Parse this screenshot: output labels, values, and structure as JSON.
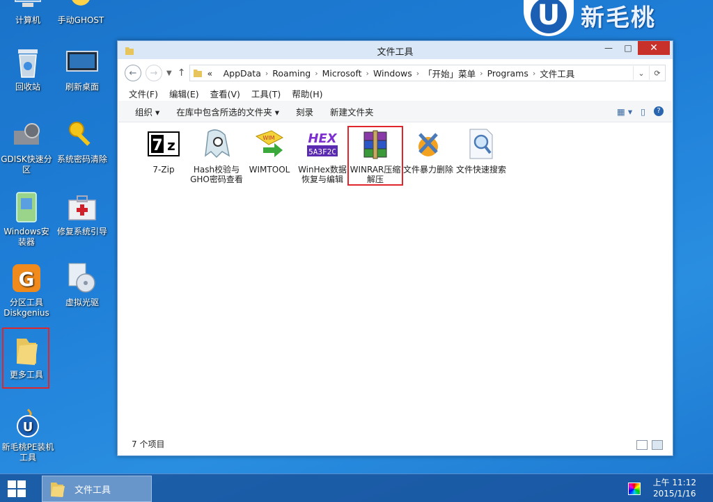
{
  "brand": {
    "logo_letter": "U",
    "text": "新毛桃"
  },
  "desktop": {
    "icons": [
      {
        "label": "计算机"
      },
      {
        "label": "手动GHOST"
      },
      {
        "label": "回收站"
      },
      {
        "label": "刷新桌面"
      },
      {
        "label": "GDISK快速分区"
      },
      {
        "label": "系统密码清除"
      },
      {
        "label": "Windows安装器"
      },
      {
        "label": "修复系统引导"
      },
      {
        "label": "分区工具Diskgenius"
      },
      {
        "label": "虚拟光驱"
      },
      {
        "label": "更多工具"
      },
      {
        "label": "新毛桃PE装机工具"
      }
    ]
  },
  "window": {
    "title": "文件工具",
    "controls": {
      "minimize": "—",
      "maximize": "□",
      "close": "✕"
    },
    "address": {
      "overflow": "«",
      "crumbs": [
        "AppData",
        "Roaming",
        "Microsoft",
        "Windows",
        "「开始」菜单",
        "Programs",
        "文件工具"
      ]
    },
    "menu": [
      "文件(F)",
      "编辑(E)",
      "查看(V)",
      "工具(T)",
      "帮助(H)"
    ],
    "commands": [
      "组织 ▾",
      "在库中包含所选的文件夹 ▾",
      "刻录",
      "新建文件夹"
    ],
    "files": [
      {
        "label": "7-Zip"
      },
      {
        "label": "Hash校验与GHO密码查看"
      },
      {
        "label": "WIMTOOL"
      },
      {
        "label": "WinHex数据恢复与编辑"
      },
      {
        "label": "WINRAR压缩解压"
      },
      {
        "label": "文件暴力删除"
      },
      {
        "label": "文件快速搜索"
      }
    ],
    "status": "7 个项目"
  },
  "taskbar": {
    "item": "文件工具",
    "time": "上午 11:12",
    "date": "2015/1/16"
  }
}
